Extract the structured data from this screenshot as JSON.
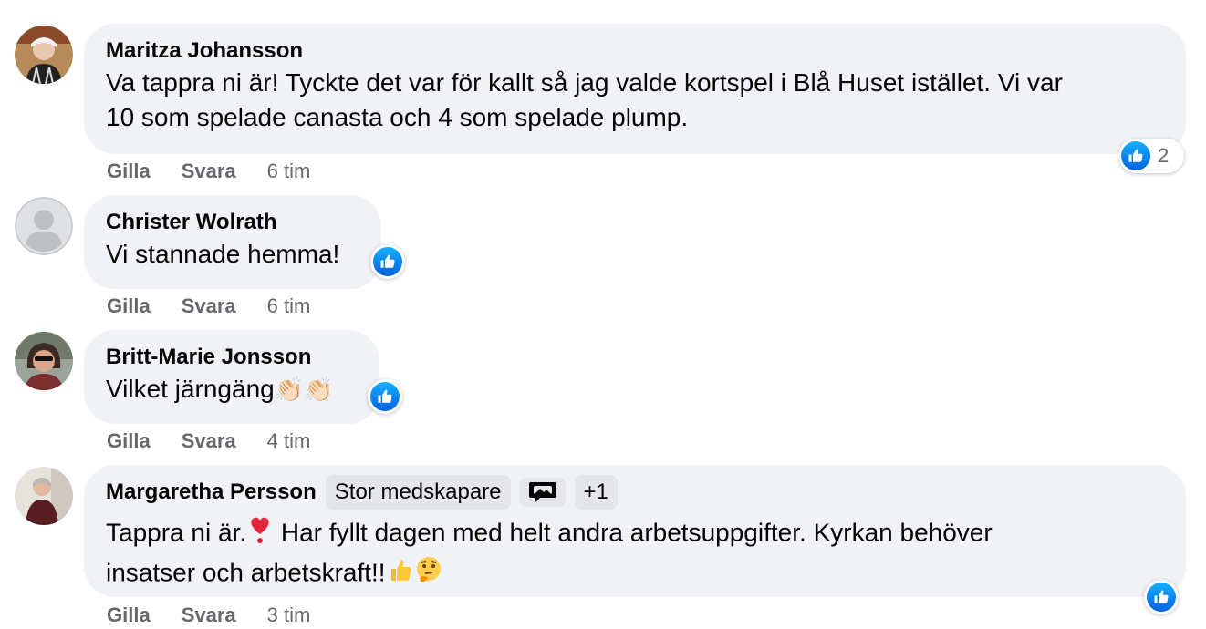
{
  "comments": [
    {
      "author": "Maritza Johansson",
      "text_line1": "Va tappra ni är! Tyckte det var för kallt så jag valde kortspel i Blå Huset istället. Vi var",
      "text_line2": "10 som spelade canasta och 4 som spelade plump.",
      "like": "Gilla",
      "reply": "Svara",
      "time": "6 tim",
      "reaction_count": "2"
    },
    {
      "author": "Christer Wolrath",
      "text": "Vi stannade hemma!",
      "like": "Gilla",
      "reply": "Svara",
      "time": "6 tim"
    },
    {
      "author": "Britt-Marie Jonsson",
      "text": "Vilket järngäng",
      "text_emoji": "👏🏻👏🏻",
      "like": "Gilla",
      "reply": "Svara",
      "time": "4 tim"
    },
    {
      "author": "Margaretha Persson",
      "badge": "Stor medskapare",
      "badge_extra": "+1",
      "text_line1_a": "Tappra ni är.",
      "text_line1_b": " Har fyllt dagen med helt andra arbetsuppgifter. Kyrkan behöver",
      "text_line2": "insatser och arbetskraft!!",
      "like": "Gilla",
      "reply": "Svara",
      "time": "3 tim"
    }
  ],
  "colors": {
    "bubble": "#f0f2f5",
    "meta": "#65676b",
    "like_blue": "#0866ff"
  },
  "icons": [
    "like-thumb-icon",
    "heart-emoji-icon",
    "thumbs-up-emoji-icon",
    "thinking-emoji-icon",
    "clap-emoji-icon",
    "chat-bubble-icon"
  ]
}
